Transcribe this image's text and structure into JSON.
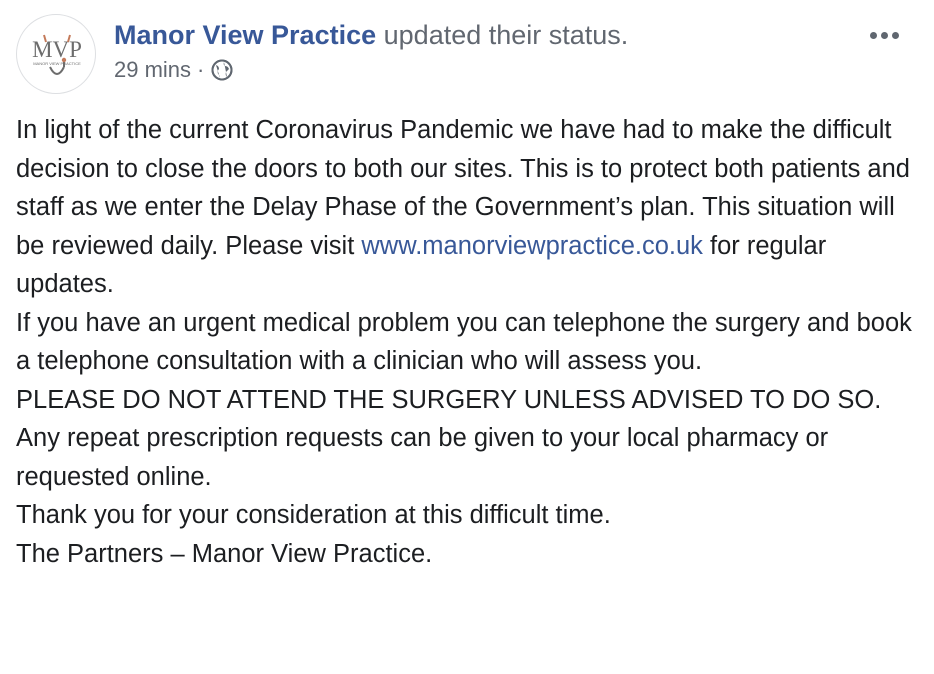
{
  "header": {
    "page_name": "Manor View Practice",
    "action": "updated their status.",
    "time": "29 mins",
    "separator": "·",
    "privacy_icon": "globe-icon",
    "more_icon": "more-options-icon",
    "avatar": {
      "letters": "MVP",
      "tagline": "MANOR VIEW PRACTICE",
      "colors": {
        "letters": "#6d6d6d",
        "accent": "#c47a5a"
      }
    }
  },
  "post": {
    "p1_before_link": "In light of the current Coronavirus Pandemic we have had to make the difficult decision to close the doors to both our sites. This is to protect both patients and staff as we enter the Delay Phase of the Government’s plan. This situation will be reviewed daily. Please visit",
    "p1_link": "www.manorviewpractice.co.uk",
    "p1_after_link": "for regular updates.",
    "p2": "If you have an urgent medical problem you can telephone the surgery and book a telephone consultation with a clinician who will assess you.",
    "p3": "PLEASE DO NOT ATTEND THE SURGERY UNLESS ADVISED TO DO SO.",
    "p4": "Any repeat prescription requests can be given to your local pharmacy or requested online.",
    "p5": "Thank you for your consideration at this difficult time.",
    "p6": "The Partners – Manor View Practice."
  },
  "colors": {
    "link": "#385898",
    "text": "#1c1e21",
    "muted": "#616770"
  }
}
